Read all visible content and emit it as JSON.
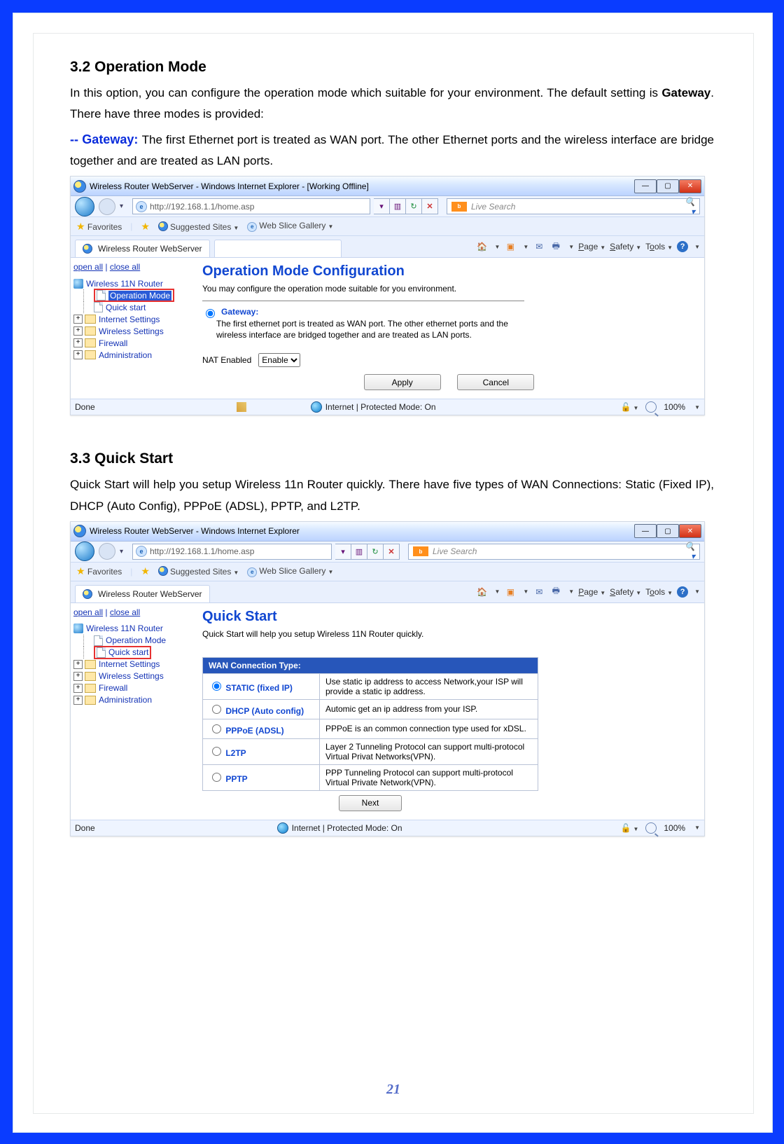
{
  "sections": {
    "s32": {
      "heading": "3.2   Operation Mode",
      "p1a": "In this option, you can configure the operation mode which suitable for your environment. The default setting is ",
      "p1b_bold": "Gateway",
      "p1c": ". There have three modes is provided:",
      "gw_label": "-- Gateway: ",
      "gw_text": "The first Ethernet port is treated as WAN port. The other Ethernet ports and the wireless interface are bridge together and are treated as LAN ports."
    },
    "s33": {
      "heading": "3.3   Quick Start",
      "p1": "Quick Start will help you setup Wireless 11n Router quickly. There have five types of WAN Connections: Static (Fixed IP), DHCP (Auto Config), PPPoE (ADSL), PPTP, and L2TP."
    }
  },
  "ie_common": {
    "url": "http://192.168.1.1/home.asp",
    "search_placeholder": "Live Search",
    "favorites": "Favorites",
    "suggested": "Suggested Sites",
    "gallery": "Web Slice Gallery",
    "tab_title": "Wireless Router WebServer",
    "page": "Page",
    "safety": "Safety",
    "tools": "Tools",
    "status_done": "Done",
    "status_mode": "Internet | Protected Mode: On",
    "zoom": "100%"
  },
  "shot1": {
    "win_title": "Wireless Router WebServer - Windows Internet Explorer - [Working Offline]",
    "open_all": "open all",
    "close_all": "close all",
    "tree": {
      "root": "Wireless 11N Router",
      "op_mode": "Operation Mode",
      "quick": "Quick start",
      "internet": "Internet Settings",
      "wireless": "Wireless Settings",
      "firewall": "Firewall",
      "admin": "Administration"
    },
    "main": {
      "h": "Operation Mode Configuration",
      "sub": "You may configure the operation mode suitable for you environment.",
      "radio_label": "Gateway:",
      "radio_desc": "The first ethernet port is treated as WAN port. The other ethernet ports and the wireless interface are bridged together and are treated as LAN ports.",
      "nat_label": "NAT Enabled",
      "nat_options": [
        "Enable"
      ],
      "apply": "Apply",
      "cancel": "Cancel"
    }
  },
  "shot2": {
    "win_title": "Wireless Router WebServer - Windows Internet Explorer",
    "open_all": "open all",
    "close_all": "close all",
    "tree": {
      "root": "Wireless 11N Router",
      "op_mode": "Operation Mode",
      "quick": "Quick start",
      "internet": "Internet Settings",
      "wireless": "Wireless Settings",
      "firewall": "Firewall",
      "admin": "Administration"
    },
    "main": {
      "h": "Quick Start",
      "sub": "Quick Start will help you setup Wireless 11N Router quickly.",
      "wan_header": "WAN Connection Type:",
      "rows": [
        {
          "label": "STATIC (fixed IP)",
          "desc": "Use static ip address to access Network,your ISP will provide a static ip address."
        },
        {
          "label": "DHCP (Auto config)",
          "desc": "Automic get an ip address from your ISP."
        },
        {
          "label": "PPPoE (ADSL)",
          "desc": "PPPoE is an common connection type used for xDSL."
        },
        {
          "label": "L2TP",
          "desc": "Layer 2 Tunneling Protocol can support multi-protocol Virtual Privat Networks(VPN)."
        },
        {
          "label": "PPTP",
          "desc": "PPP Tunneling Protocol can support multi-protocol Virtual Private Network(VPN)."
        }
      ],
      "next": "Next"
    }
  },
  "page_number": "21"
}
